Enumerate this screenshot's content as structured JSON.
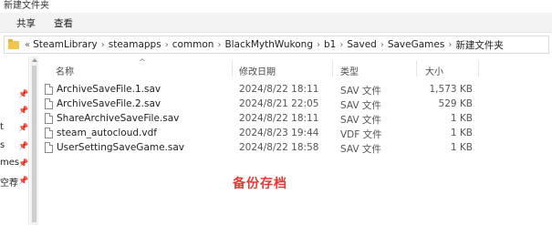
{
  "window": {
    "title": "新建文件夹"
  },
  "ribbon": {
    "tabs": [
      "共享",
      "查看"
    ]
  },
  "address": {
    "lead": "«",
    "separator": "›",
    "crumbs": [
      "SteamLibrary",
      "steamapps",
      "common",
      "BlackMythWukong",
      "b1",
      "Saved",
      "SaveGames",
      "新建文件夹"
    ]
  },
  "nav": {
    "items": [
      "t",
      "s",
      "mes",
      "空荐"
    ]
  },
  "list": {
    "columns": {
      "name": "名称",
      "date": "修改日期",
      "type": "类型",
      "size": "大小"
    },
    "files": [
      {
        "name": "ArchiveSaveFile.1.sav",
        "date": "2024/8/22 18:11",
        "type": "SAV 文件",
        "size": "1,573 KB"
      },
      {
        "name": "ArchiveSaveFile.2.sav",
        "date": "2024/8/21 22:05",
        "type": "SAV 文件",
        "size": "529 KB"
      },
      {
        "name": "ShareArchiveSaveFile.sav",
        "date": "2024/8/22 18:11",
        "type": "SAV 文件",
        "size": "1 KB"
      },
      {
        "name": "steam_autocloud.vdf",
        "date": "2024/8/23 19:44",
        "type": "VDF 文件",
        "size": "1 KB"
      },
      {
        "name": "UserSettingSaveGame.sav",
        "date": "2024/8/22 18:58",
        "type": "SAV 文件",
        "size": "1 KB"
      }
    ]
  },
  "annotation": {
    "text": "备份存档",
    "color": "#e53935"
  },
  "colors": {
    "folder": "#f3c44e",
    "ribbon_bg": "#f3f3f3"
  },
  "icons": {
    "folder": "folder-icon",
    "file": "file-icon",
    "pin": "pin-icon",
    "sort": "sort-up-icon"
  }
}
